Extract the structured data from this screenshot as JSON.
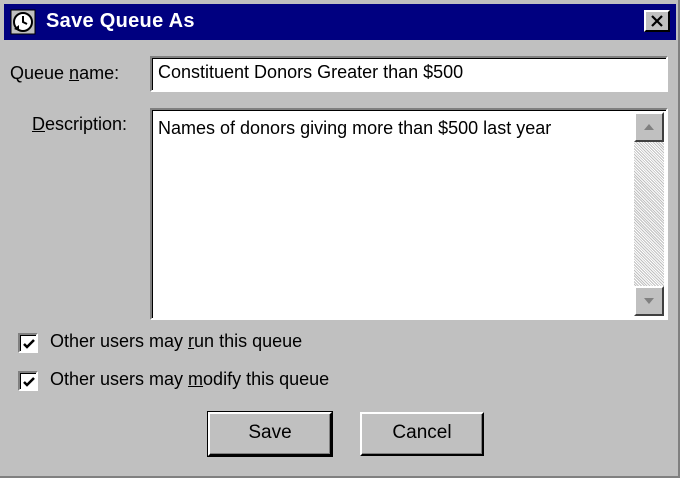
{
  "window": {
    "title": "Save Queue As"
  },
  "form": {
    "queue_name_label_pre": "Queue ",
    "queue_name_label_accel": "n",
    "queue_name_label_post": "ame:",
    "queue_name_value": "Constituent Donors Greater than $500",
    "description_label_accel": "D",
    "description_label_post": "escription:",
    "description_value": "Names of donors giving more than $500 last year"
  },
  "options": {
    "run": {
      "pre": "Other users may ",
      "accel": "r",
      "post": "un this queue",
      "checked": true
    },
    "modify": {
      "pre": "Other users may ",
      "accel": "m",
      "post": "odify this queue",
      "checked": true
    }
  },
  "buttons": {
    "save": "Save",
    "cancel": "Cancel"
  },
  "icons": {
    "window": "queue-icon",
    "close": "close-icon",
    "up": "scroll-up-arrow-icon",
    "down": "scroll-down-arrow-icon",
    "check": "check-icon"
  },
  "colors": {
    "titlebar": "#000080",
    "face": "#c0c0c0"
  }
}
